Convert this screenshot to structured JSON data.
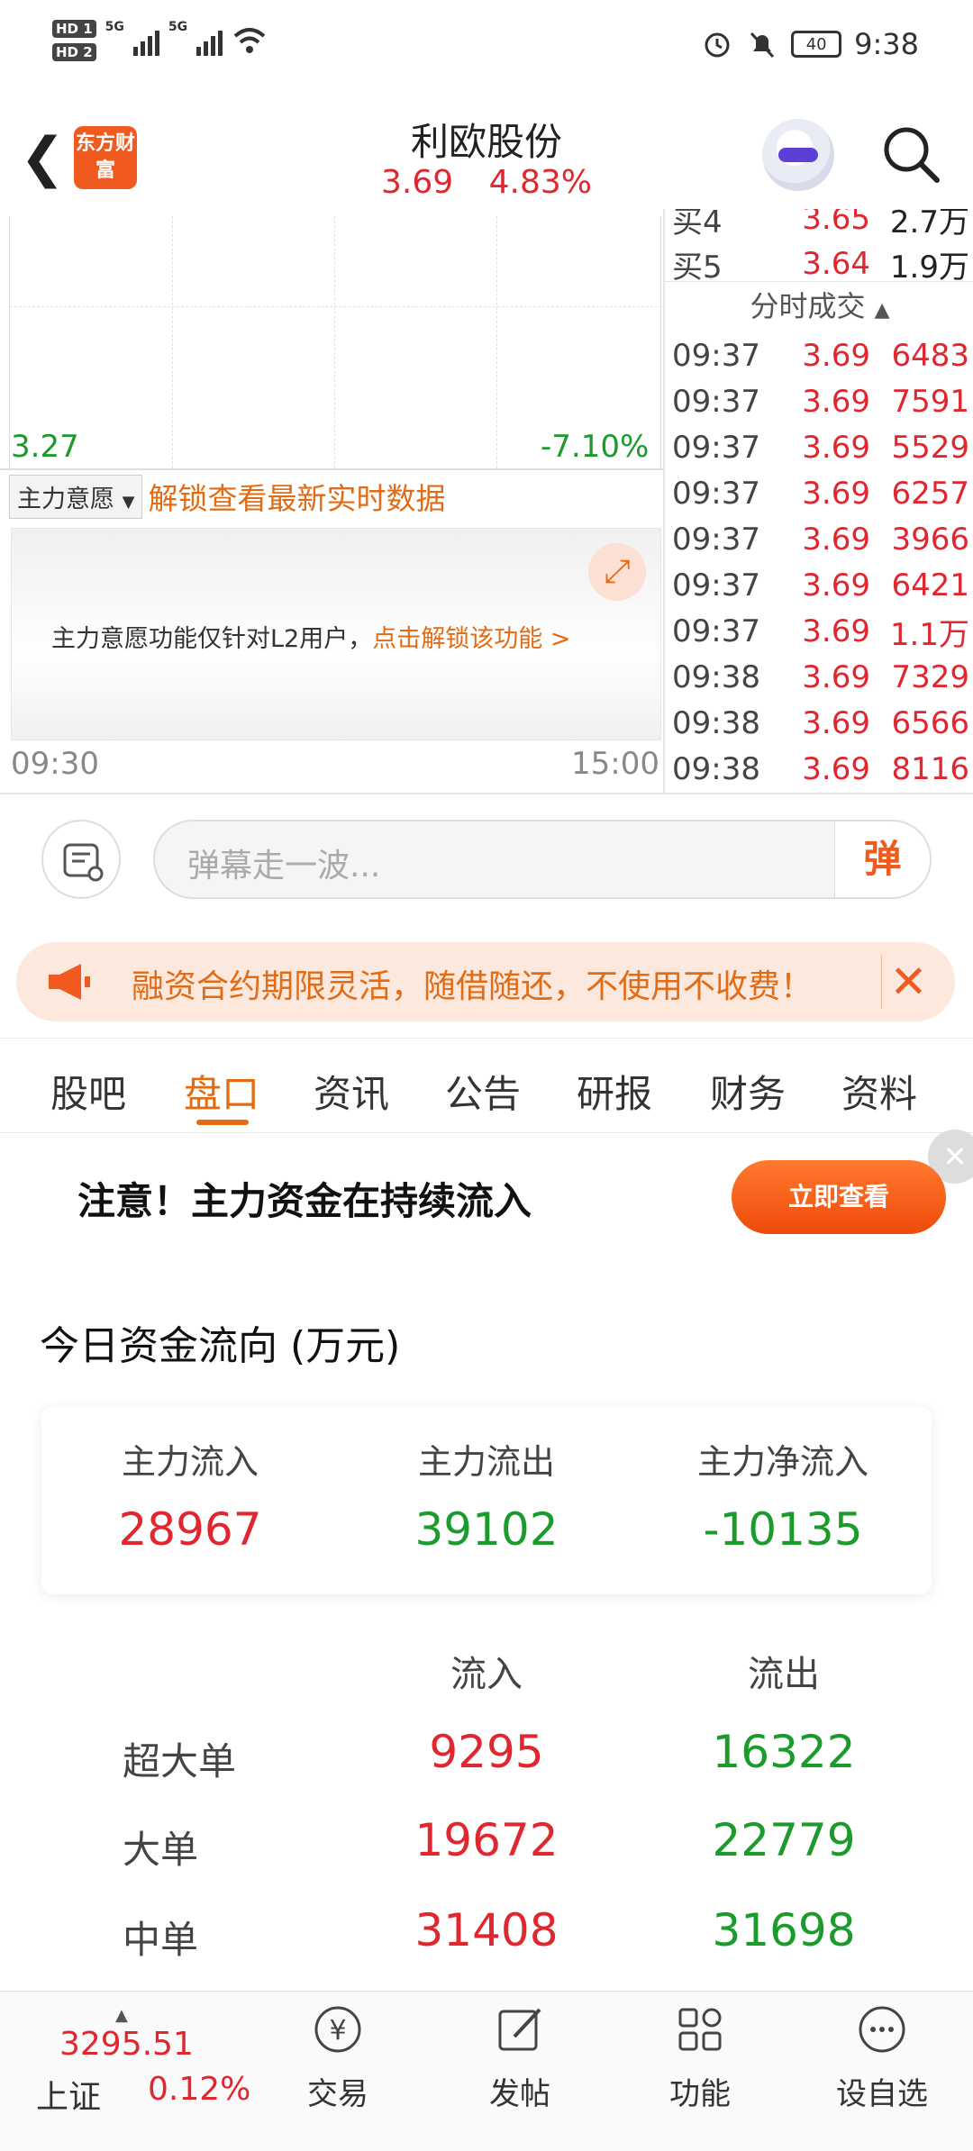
{
  "status_bar": {
    "time": "9:38",
    "battery": "40",
    "net1": "5G",
    "net2": "5G",
    "hd1": "HD 1",
    "hd2": "HD 2"
  },
  "header": {
    "logo_text": "东方财富",
    "stock_name": "利欧股份",
    "price": "3.69",
    "change_pct": "4.83%"
  },
  "chart": {
    "low_price": "3.27",
    "low_pct": "-7.10%",
    "time_start": "09:30",
    "time_end": "15:00",
    "zl_select": "主力意愿",
    "zl_unlock": "解锁查看最新实时数据",
    "l2_text": "主力意愿功能仅针对L2用户，",
    "l2_link": "点击解锁该功能 >"
  },
  "order_book": {
    "bids": [
      {
        "label": "买4",
        "price": "3.65",
        "vol": "2.7万"
      },
      {
        "label": "买5",
        "price": "3.64",
        "vol": "1.9万"
      }
    ],
    "ticks_title": "分时成交",
    "ticks": [
      {
        "time": "09:37",
        "price": "3.69",
        "vol": "6483"
      },
      {
        "time": "09:37",
        "price": "3.69",
        "vol": "7591"
      },
      {
        "time": "09:37",
        "price": "3.69",
        "vol": "5529"
      },
      {
        "time": "09:37",
        "price": "3.69",
        "vol": "6257"
      },
      {
        "time": "09:37",
        "price": "3.69",
        "vol": "3966"
      },
      {
        "time": "09:37",
        "price": "3.69",
        "vol": "6421"
      },
      {
        "time": "09:37",
        "price": "3.69",
        "vol": "1.1万"
      },
      {
        "time": "09:38",
        "price": "3.69",
        "vol": "7329"
      },
      {
        "time": "09:38",
        "price": "3.69",
        "vol": "6566"
      },
      {
        "time": "09:38",
        "price": "3.69",
        "vol": "8116"
      }
    ]
  },
  "danmu": {
    "placeholder": "弹幕走一波...",
    "send": "弹"
  },
  "promo": {
    "text": "融资合约期限灵活，随借随还，不使用不收费！"
  },
  "tabs": [
    "股吧",
    "盘口",
    "资讯",
    "公告",
    "研报",
    "财务",
    "资料"
  ],
  "notice": {
    "text": "注意！主力资金在持续流入",
    "button": "立即查看"
  },
  "fund_flow": {
    "title": "今日资金流向 (万元)",
    "summary": [
      {
        "label": "主力流入",
        "value": "28967"
      },
      {
        "label": "主力流出",
        "value": "39102"
      },
      {
        "label": "主力净流入",
        "value": "-10135"
      }
    ],
    "col_in": "流入",
    "col_out": "流出",
    "rows": [
      {
        "label": "超大单",
        "in": "9295",
        "out": "16322"
      },
      {
        "label": "大单",
        "in": "19672",
        "out": "22779"
      },
      {
        "label": "中单",
        "in": "31408",
        "out": "31698"
      }
    ]
  },
  "bottom_nav": {
    "index_value": "3295.51",
    "index_name": "上证",
    "index_pct": "0.12%",
    "items": [
      "交易",
      "发帖",
      "功能",
      "设自选"
    ]
  },
  "colors": {
    "up": "#e0262e",
    "down": "#1a9b2b",
    "accent": "#e36b14",
    "brand": "#f05a1f"
  }
}
